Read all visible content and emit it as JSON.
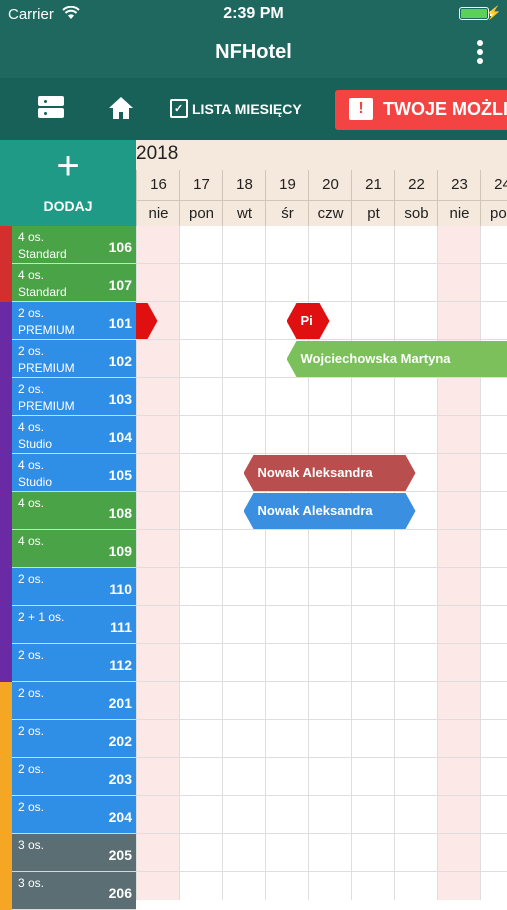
{
  "status": {
    "carrier": "Carrier",
    "time": "2:39 PM"
  },
  "app": {
    "title": "NFHotel"
  },
  "toolbar": {
    "list_label": "LISTA MIESIĘCY",
    "alert_label": "TWOJE MOŻLIW",
    "alert_icon": "!"
  },
  "add": {
    "plus": "+",
    "label": "DODAJ"
  },
  "calendar": {
    "year": "2018",
    "days": [
      {
        "num": "16",
        "name": "nie",
        "weekend": true
      },
      {
        "num": "17",
        "name": "pon",
        "weekend": false
      },
      {
        "num": "18",
        "name": "wt",
        "weekend": false
      },
      {
        "num": "19",
        "name": "śr",
        "weekend": false
      },
      {
        "num": "20",
        "name": "czw",
        "weekend": false
      },
      {
        "num": "21",
        "name": "pt",
        "weekend": false
      },
      {
        "num": "22",
        "name": "sob",
        "weekend": false
      },
      {
        "num": "23",
        "name": "nie",
        "weekend": true
      },
      {
        "num": "24",
        "name": "pon",
        "weekend": false
      }
    ]
  },
  "colors": {
    "weekend": "#fde8e8",
    "teal": "#1e6860",
    "alert": "#f44343"
  },
  "rooms": [
    {
      "cap": "4 os.",
      "type": "Standard",
      "no": "106",
      "color": "#4ba348",
      "strip": "#d32f2f"
    },
    {
      "cap": "4 os.",
      "type": "Standard",
      "no": "107",
      "color": "#4ba348",
      "strip": "#d32f2f"
    },
    {
      "cap": "2 os.",
      "type": "PREMIUM",
      "no": "101",
      "color": "#2f8fe6",
      "strip": "#6a2aa3"
    },
    {
      "cap": "2 os.",
      "type": "PREMIUM",
      "no": "102",
      "color": "#2f8fe6",
      "strip": "#6a2aa3"
    },
    {
      "cap": "2 os.",
      "type": "PREMIUM",
      "no": "103",
      "color": "#2f8fe6",
      "strip": "#6a2aa3"
    },
    {
      "cap": "4 os.",
      "type": "Studio",
      "no": "104",
      "color": "#2f8fe6",
      "strip": "#6a2aa3"
    },
    {
      "cap": "4 os.",
      "type": "Studio",
      "no": "105",
      "color": "#2f8fe6",
      "strip": "#6a2aa3"
    },
    {
      "cap": "4 os.",
      "type": "",
      "no": "108",
      "color": "#4ba348",
      "strip": "#6a2aa3"
    },
    {
      "cap": "4 os.",
      "type": "",
      "no": "109",
      "color": "#4ba348",
      "strip": "#6a2aa3"
    },
    {
      "cap": "2 os.",
      "type": "",
      "no": "110",
      "color": "#2f8fe6",
      "strip": "#6a2aa3"
    },
    {
      "cap": "2 + 1 os.",
      "type": "",
      "no": "111",
      "color": "#2f8fe6",
      "strip": "#6a2aa3"
    },
    {
      "cap": "2 os.",
      "type": "",
      "no": "112",
      "color": "#2f8fe6",
      "strip": "#6a2aa3"
    },
    {
      "cap": "2 os.",
      "type": "",
      "no": "201",
      "color": "#2f8fe6",
      "strip": "#f5a623"
    },
    {
      "cap": "2 os.",
      "type": "",
      "no": "202",
      "color": "#2f8fe6",
      "strip": "#f5a623"
    },
    {
      "cap": "2 os.",
      "type": "",
      "no": "203",
      "color": "#2f8fe6",
      "strip": "#f5a623"
    },
    {
      "cap": "2 os.",
      "type": "",
      "no": "204",
      "color": "#2f8fe6",
      "strip": "#f5a623"
    },
    {
      "cap": "3 os.",
      "type": "",
      "no": "205",
      "color": "#5a6e73",
      "strip": "#f5a623"
    },
    {
      "cap": "3 os.",
      "type": "",
      "no": "206",
      "color": "#5a6e73",
      "strip": "#f5a623"
    }
  ],
  "reservations": [
    {
      "label": "",
      "room": 2,
      "start": 0,
      "end": 0.5,
      "color": "#e01010"
    },
    {
      "label": "Pi",
      "room": 2,
      "start": 3.5,
      "end": 4.5,
      "color": "#e01010"
    },
    {
      "label": "Wojciechowska Martyna",
      "room": 3,
      "start": 3.5,
      "end": 9,
      "color": "#7bc05a"
    },
    {
      "label": "Nowak Aleksandra",
      "room": 6,
      "start": 2.5,
      "end": 6.5,
      "color": "#b94e4e"
    },
    {
      "label": "Nowak Aleksandra",
      "room": 7,
      "start": 2.5,
      "end": 6.5,
      "color": "#3b8fe0"
    }
  ]
}
